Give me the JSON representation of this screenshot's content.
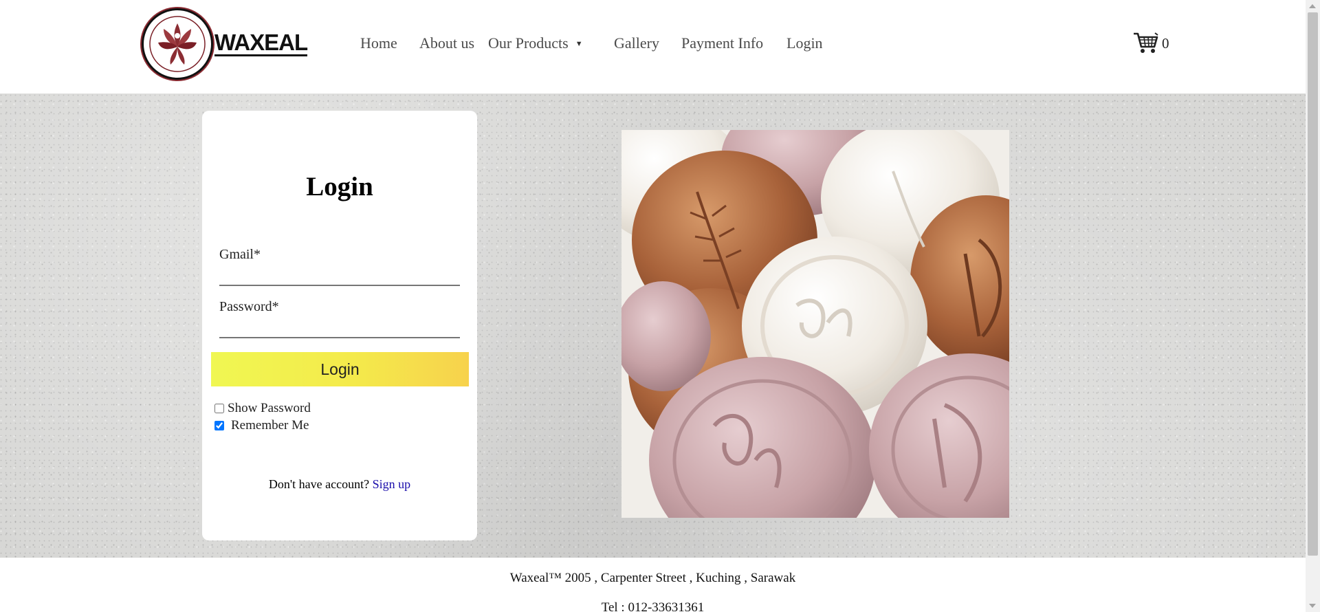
{
  "header": {
    "logo_text": "WAXEAL",
    "nav": [
      {
        "label": "Home"
      },
      {
        "label": "About us"
      },
      {
        "label": "Our Products",
        "dropdown_icon": "caret-down-icon"
      },
      {
        "label": "Gallery"
      },
      {
        "label": "Payment Info"
      },
      {
        "label": "Login"
      }
    ],
    "cart_icon": "shopping-cart-icon",
    "cart_count": "0"
  },
  "login": {
    "title": "Login",
    "email_label": "Gmail*",
    "email_value": "",
    "password_label": "Password*",
    "password_value": "",
    "submit_label": "Login",
    "show_password_label": "Show Password",
    "show_password_checked": false,
    "remember_me_label": "Remember Me",
    "remember_me_checked": true,
    "signup_prompt": "Don't have account?",
    "signup_link": "Sign up"
  },
  "hero_image": {
    "subject": "wax seals"
  },
  "footer": {
    "address": "Waxeal™ 2005 , Carpenter Street , Kuching , Sarawak",
    "phone": "Tel : 012-33631361"
  },
  "colors": {
    "login_button_gradient_start": "#f0f752",
    "login_button_gradient_end": "#f7d24c",
    "link": "#1a0dab",
    "hero_background": "#d6d6d4"
  }
}
